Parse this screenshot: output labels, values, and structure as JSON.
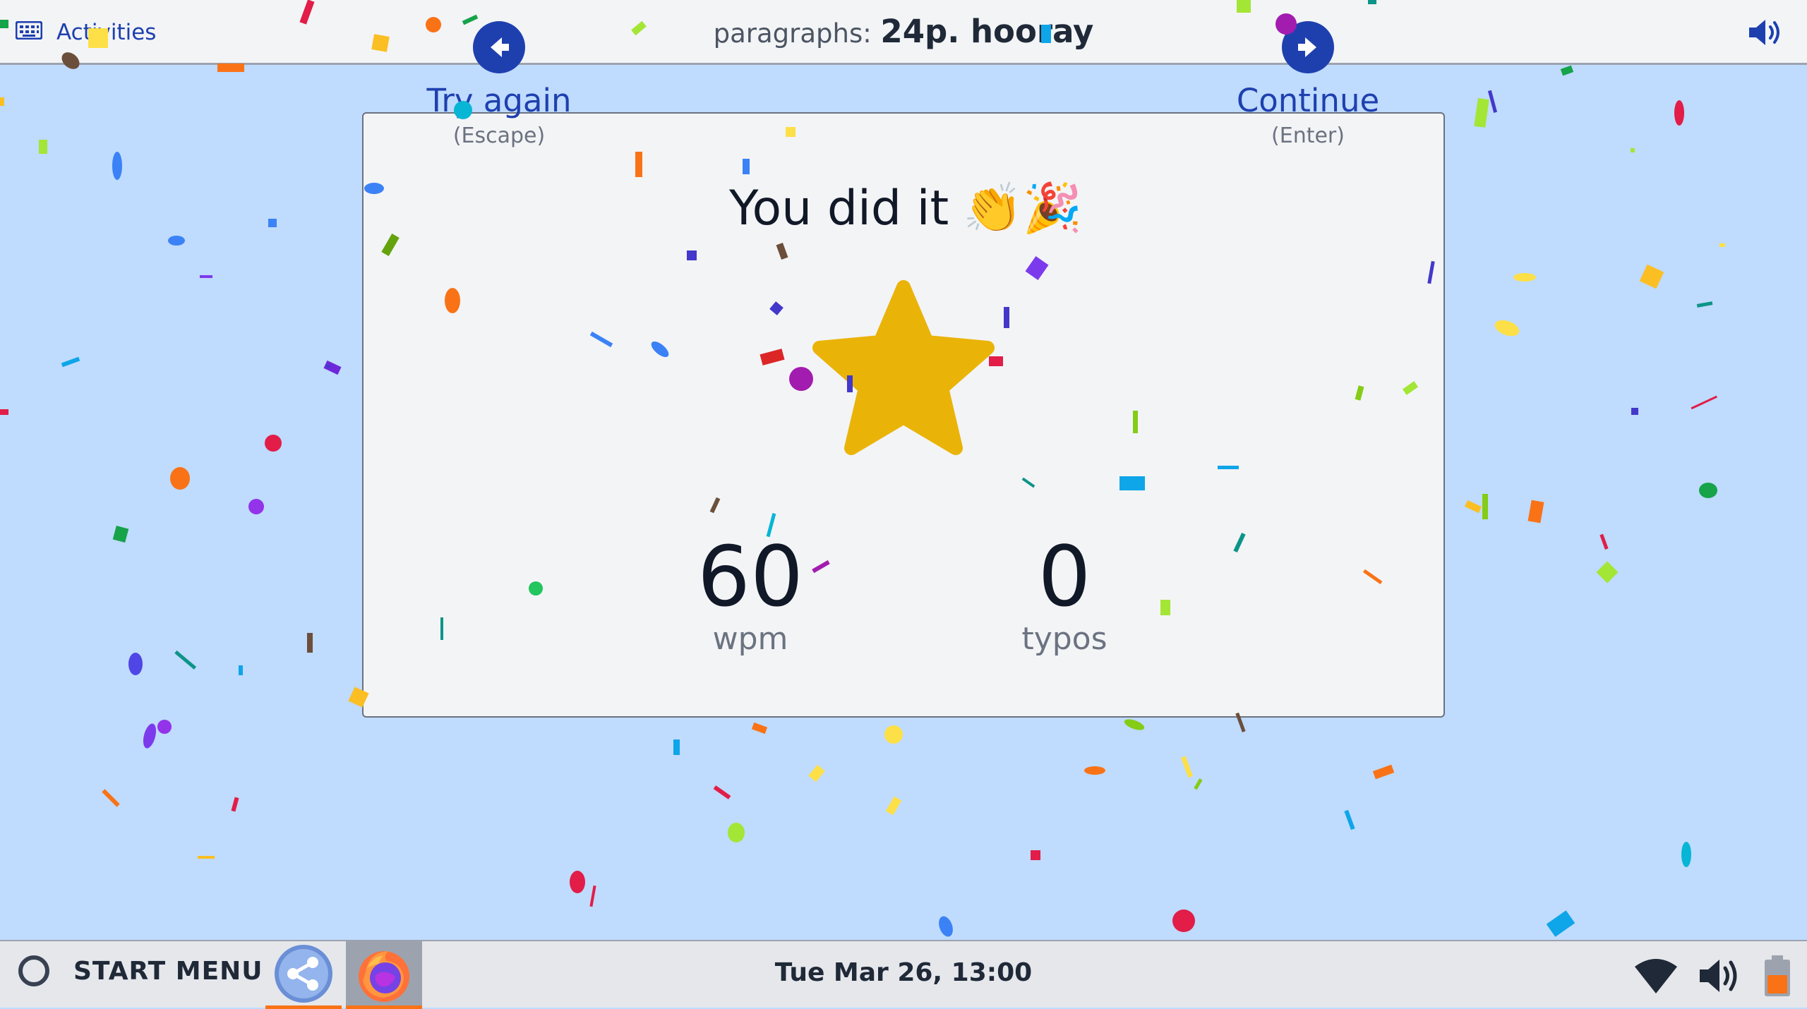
{
  "topbar": {
    "activities_label": "Activities",
    "keyboard_icon": "keyboard-icon",
    "title_label": "paragraphs:",
    "title_value": "24p. hooray",
    "sound_icon": "volume-icon"
  },
  "result": {
    "try_again_label": "Try again",
    "try_again_hint": "(Escape)",
    "continue_label": "Continue",
    "continue_hint": "(Enter)",
    "headline": "You did it",
    "headline_emojis": "👏🎉",
    "rating_icon": "star-icon",
    "wpm_value": "60",
    "wpm_unit": "wpm",
    "typos_value": "0",
    "typos_unit": "typos"
  },
  "taskbar": {
    "start_label": "START MENU",
    "clock": "Tue Mar 26,  13:00",
    "apps": [
      "share-app-icon",
      "firefox-icon"
    ],
    "tray_icons": [
      "wifi-icon",
      "volume-icon",
      "battery-icon"
    ]
  },
  "colors": {
    "accent": "#1e40af",
    "background": "#bfdbfe",
    "card": "#f3f4f6",
    "star": "#eab308",
    "taskbar_active": "#f97316"
  }
}
